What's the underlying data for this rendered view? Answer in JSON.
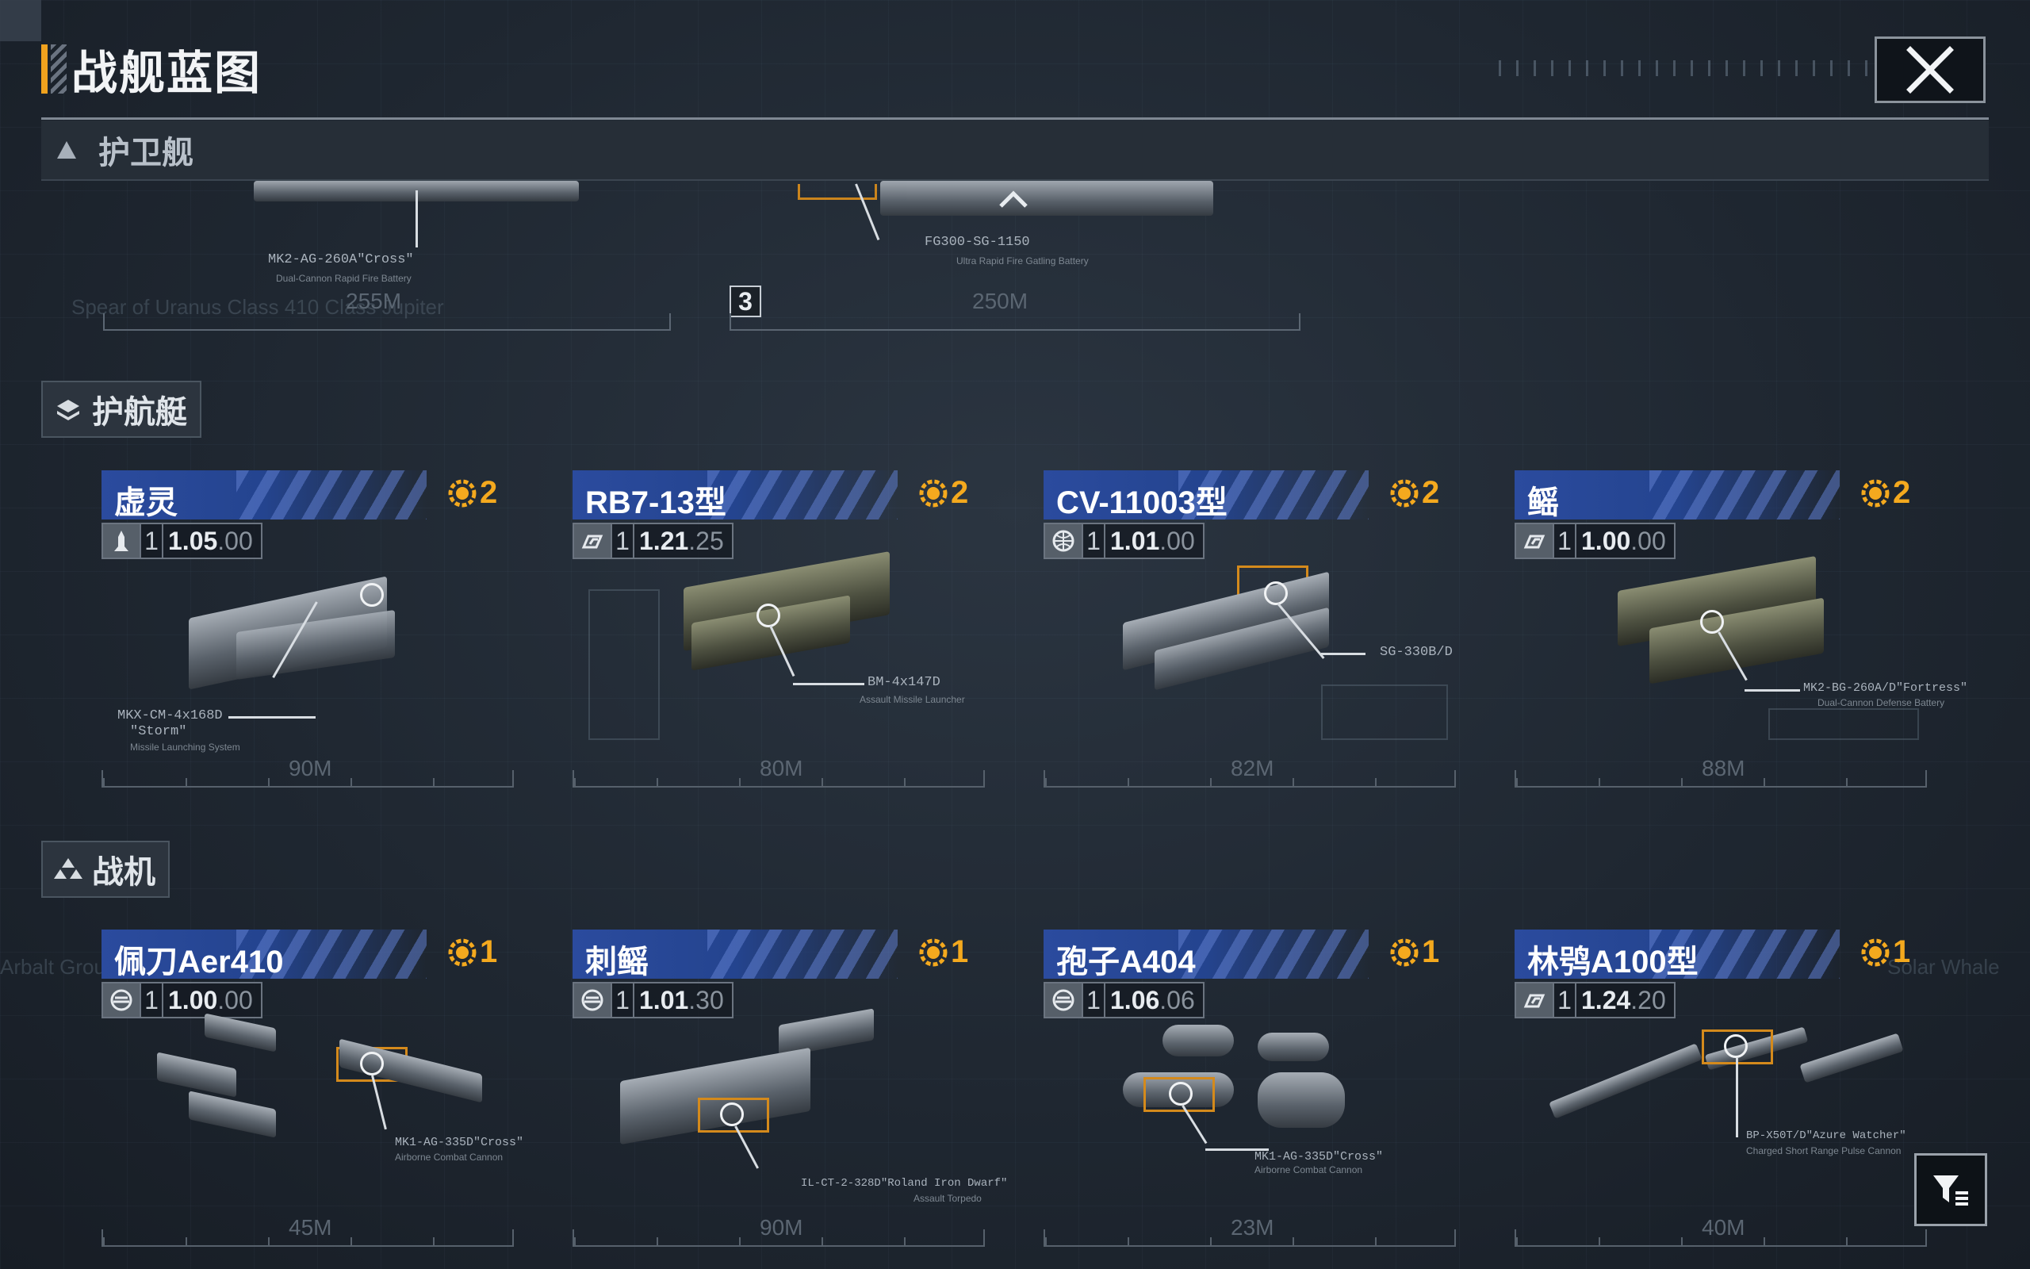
{
  "header": {
    "title": "战舰蓝图",
    "close_icon": "close-icon"
  },
  "sticky_category": {
    "label": "护卫舰",
    "icon": "triangle-up-icon"
  },
  "scrolled_remnants": [
    {
      "weapon": "MK2-AG-260A\"Cross\"",
      "weapon_sub": "Dual-Cannon Rapid Fire Battery",
      "size": "255M"
    },
    {
      "weapon": "FG300-SG-1150",
      "weapon_sub": "Ultra Rapid Fire Gatling Battery",
      "size": "250M",
      "rank": "3"
    }
  ],
  "sections": [
    {
      "label": "护航艇",
      "icon": "escort-layers-icon",
      "ships": [
        {
          "name": "虚灵",
          "cost": "2",
          "type_icon": "missile-icon",
          "level": "1",
          "stat_hi": "1.05",
          "stat_lo": ".00",
          "weapon": "MKX-CM-4x168D",
          "weapon2": "\"Storm\"",
          "weapon_sub": "Missile Launching System",
          "size": "90M"
        },
        {
          "name": "RB7-13型",
          "cost": "2",
          "type_icon": "speed-icon",
          "level": "1",
          "stat_hi": "1.21",
          "stat_lo": ".25",
          "weapon": "BM-4x147D",
          "weapon2": "",
          "weapon_sub": "Assault Missile Launcher",
          "size": "80M"
        },
        {
          "name": "CV-11003型",
          "cost": "2",
          "type_icon": "globe-icon",
          "level": "1",
          "stat_hi": "1.01",
          "stat_lo": ".00",
          "weapon": "SG-330B/D",
          "weapon2": "",
          "weapon_sub": "",
          "size": "82M"
        },
        {
          "name": "鳐",
          "cost": "2",
          "type_icon": "speed-icon",
          "level": "1",
          "stat_hi": "1.00",
          "stat_lo": ".00",
          "weapon": "MK2-BG-260A/D\"Fortress\"",
          "weapon2": "",
          "weapon_sub": "Dual-Cannon Defense Battery",
          "size": "88M"
        }
      ]
    },
    {
      "label": "战机",
      "icon": "fighter-squad-icon",
      "ships": [
        {
          "name": "佩刀Aer410",
          "cost": "1",
          "type_icon": "carrier-icon",
          "level": "1",
          "stat_hi": "1.00",
          "stat_lo": ".00",
          "weapon": "MK1-AG-335D\"Cross\"",
          "weapon2": "",
          "weapon_sub": "Airborne Combat Cannon",
          "size": "45M"
        },
        {
          "name": "刺鳐",
          "cost": "1",
          "type_icon": "carrier-icon",
          "level": "1",
          "stat_hi": "1.01",
          "stat_lo": ".30",
          "weapon": "IL-CT-2-328D\"Roland Iron Dwarf\"",
          "weapon2": "",
          "weapon_sub": "Assault Torpedo",
          "size": "90M"
        },
        {
          "name": "孢子A404",
          "cost": "1",
          "type_icon": "carrier-icon",
          "level": "1",
          "stat_hi": "1.06",
          "stat_lo": ".06",
          "weapon": "MK1-AG-335D\"Cross\"",
          "weapon2": "",
          "weapon_sub": "Airborne Combat Cannon",
          "size": "23M"
        },
        {
          "name": "林鸮A100型",
          "cost": "1",
          "type_icon": "speed-icon",
          "level": "1",
          "stat_hi": "1.24",
          "stat_lo": ".20",
          "weapon": "BP-X50T/D\"Azure Watcher\"",
          "weapon2": "",
          "weapon_sub": "Charged Short Range Pulse Cannon",
          "size": "40M"
        }
      ]
    }
  ],
  "filter_icon": "filter-icon",
  "colors": {
    "accent": "#f0a21e",
    "banner_blue": "#2b4b9e",
    "cost_gold": "#f4a91e",
    "background": "#1f2731"
  }
}
